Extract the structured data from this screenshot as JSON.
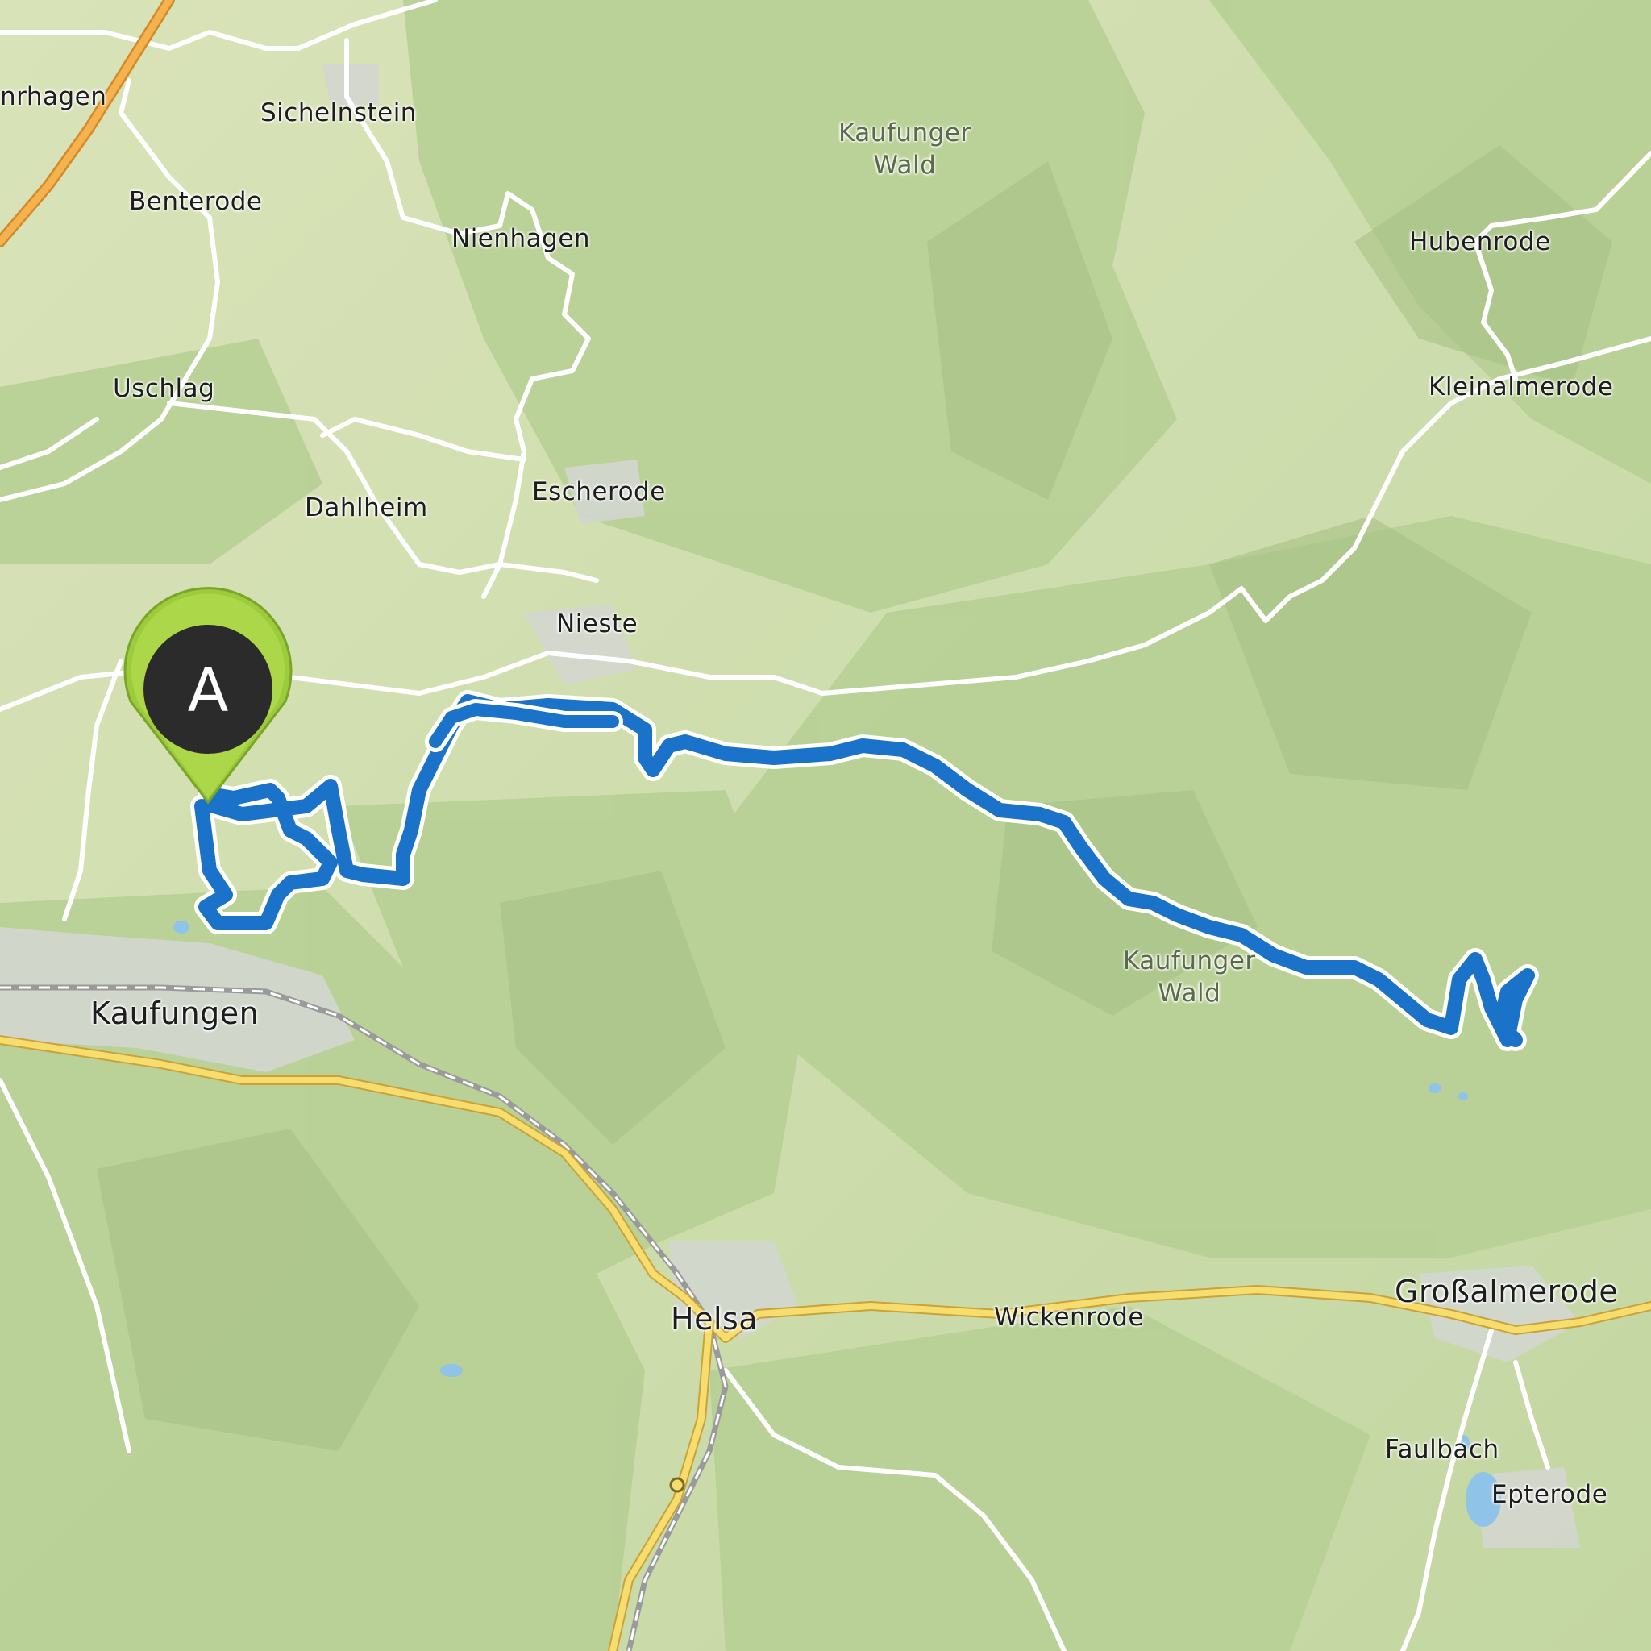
{
  "map": {
    "places": {
      "lichtenau_partial": "nrhagen",
      "sichelnstein": "Sichelnstein",
      "benterode": "Benterode",
      "nienhagen": "Nienhagen",
      "uschlag": "Uschlag",
      "dahlheim": "Dahlheim",
      "escherode": "Escherode",
      "nieste": "Nieste",
      "kaufungen": "Kaufungen",
      "hubenrode": "Hubenrode",
      "kleinalmerode": "Kleinalmerode",
      "helsa": "Helsa",
      "wickenrode": "Wickenrode",
      "grossalmerode": "Großalmerode",
      "faulbach": "Faulbach",
      "epterode": "Epterode"
    },
    "areas": {
      "forest_north_line1": "Kaufunger",
      "forest_north_line2": "Wald",
      "forest_south_line1": "Kaufunger",
      "forest_south_line2": "Wald"
    },
    "marker": {
      "label": "A",
      "color": "#9ccc3c"
    },
    "route_color": "#1a73c8",
    "colors": {
      "land": "#dfe7c2",
      "forest": "#b9d19a",
      "settlement": "#d4d7d2",
      "major_road": "#f2c94c",
      "water": "#8fc3e8"
    }
  }
}
